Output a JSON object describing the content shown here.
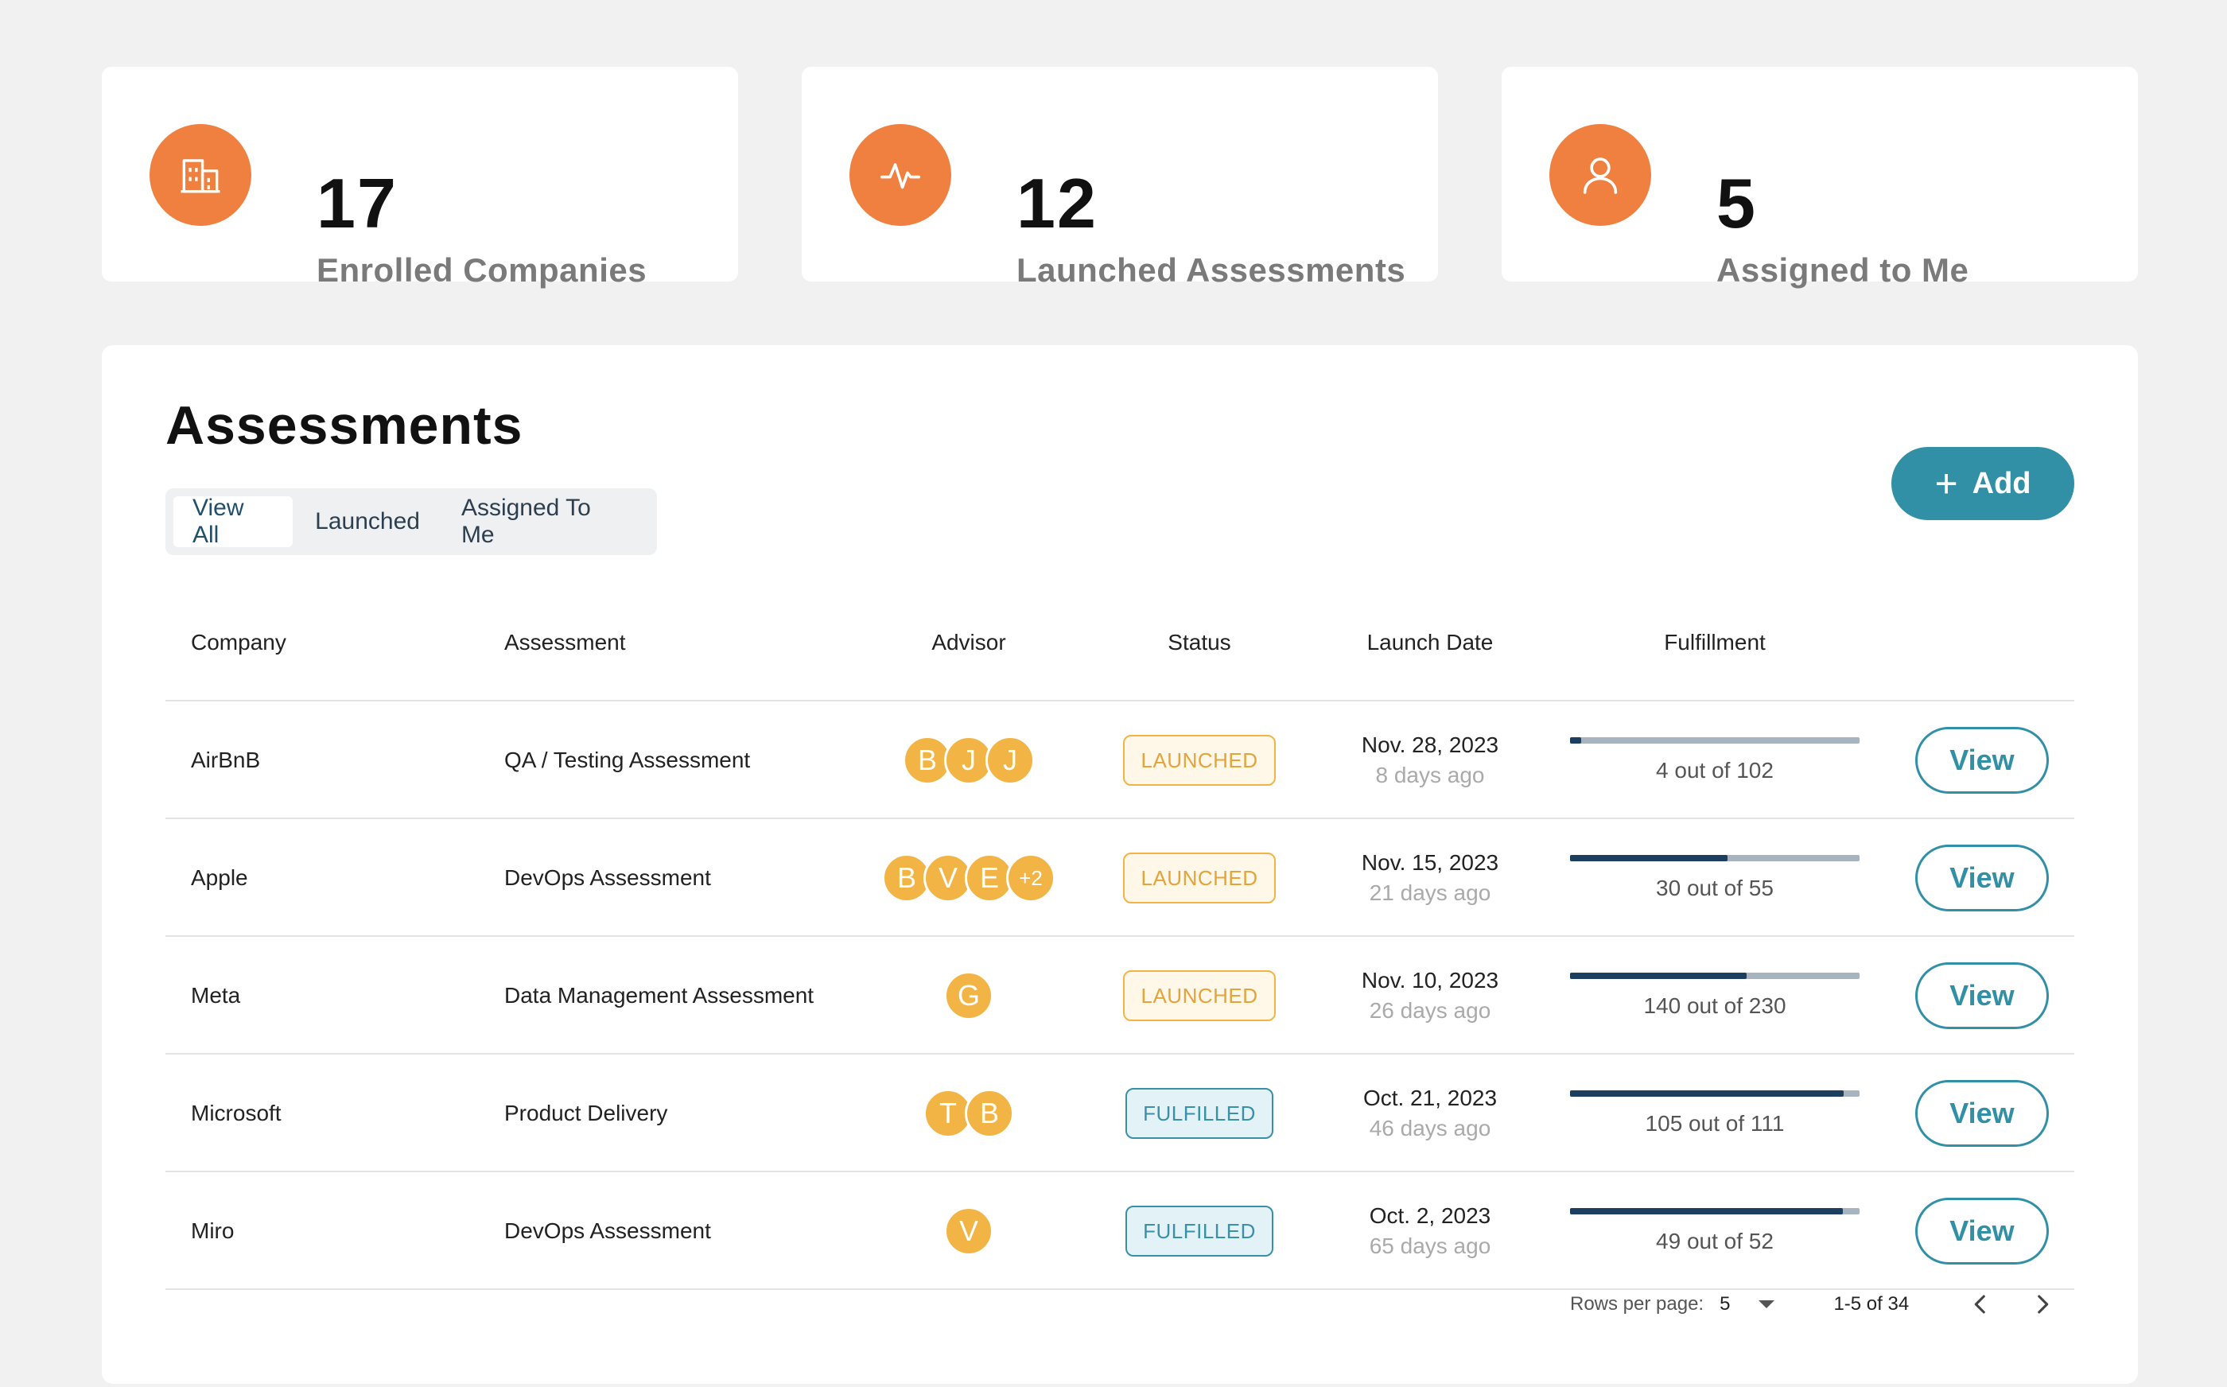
{
  "stats": [
    {
      "number": "17",
      "label": "Enrolled Companies",
      "icon": "building-icon"
    },
    {
      "number": "12",
      "label": "Launched Assessments",
      "icon": "activity-icon"
    },
    {
      "number": "5",
      "label": "Assigned to Me",
      "icon": "user-icon"
    }
  ],
  "colors": {
    "accent": "#f08040",
    "primary": "#3190a6",
    "avatar": "#f2b444",
    "bar_fill": "#1c3f5f",
    "bar_track": "#a7b4c0"
  },
  "assessments": {
    "title": "Assessments",
    "tabs": [
      {
        "label": "View All",
        "active": true
      },
      {
        "label": "Launched",
        "active": false
      },
      {
        "label": "Assigned To Me",
        "active": false
      }
    ],
    "add_label": "Add",
    "columns": [
      "Company",
      "Assessment",
      "Advisor",
      "Status",
      "Launch Date",
      "Fulfillment"
    ],
    "rows": [
      {
        "company": "AirBnB",
        "assessment": "QA / Testing Assessment",
        "advisors": [
          "B",
          "J",
          "J"
        ],
        "status": "LAUNCHED",
        "status_type": "launched",
        "date": "Nov. 28, 2023",
        "relative": "8 days ago",
        "fulfill_text": "4 out of 102",
        "fulfill_ratio": 0.039,
        "action": "View"
      },
      {
        "company": "Apple",
        "assessment": "DevOps Assessment",
        "advisors": [
          "B",
          "V",
          "E",
          "+2"
        ],
        "status": "LAUNCHED",
        "status_type": "launched",
        "date": "Nov. 15, 2023",
        "relative": "21 days ago",
        "fulfill_text": "30 out of 55",
        "fulfill_ratio": 0.545,
        "action": "View"
      },
      {
        "company": "Meta",
        "assessment": "Data Management Assessment",
        "advisors": [
          "G"
        ],
        "status": "LAUNCHED",
        "status_type": "launched",
        "date": "Nov. 10, 2023",
        "relative": "26 days ago",
        "fulfill_text": "140 out of 230",
        "fulfill_ratio": 0.609,
        "action": "View"
      },
      {
        "company": "Microsoft",
        "assessment": "Product Delivery",
        "advisors": [
          "T",
          "B"
        ],
        "status": "FULFILLED",
        "status_type": "fulfilled",
        "date": "Oct. 21, 2023",
        "relative": "46 days ago",
        "fulfill_text": "105 out of 111",
        "fulfill_ratio": 0.946,
        "action": "View"
      },
      {
        "company": "Miro",
        "assessment": "DevOps Assessment",
        "advisors": [
          "V"
        ],
        "status": "FULFILLED",
        "status_type": "fulfilled",
        "date": "Oct. 2, 2023",
        "relative": "65 days ago",
        "fulfill_text": "49 out of 52",
        "fulfill_ratio": 0.942,
        "action": "View"
      }
    ]
  },
  "pagination": {
    "rows_per_page_label": "Rows per page:",
    "rows_per_page": "5",
    "range": "1-5 of 34"
  }
}
